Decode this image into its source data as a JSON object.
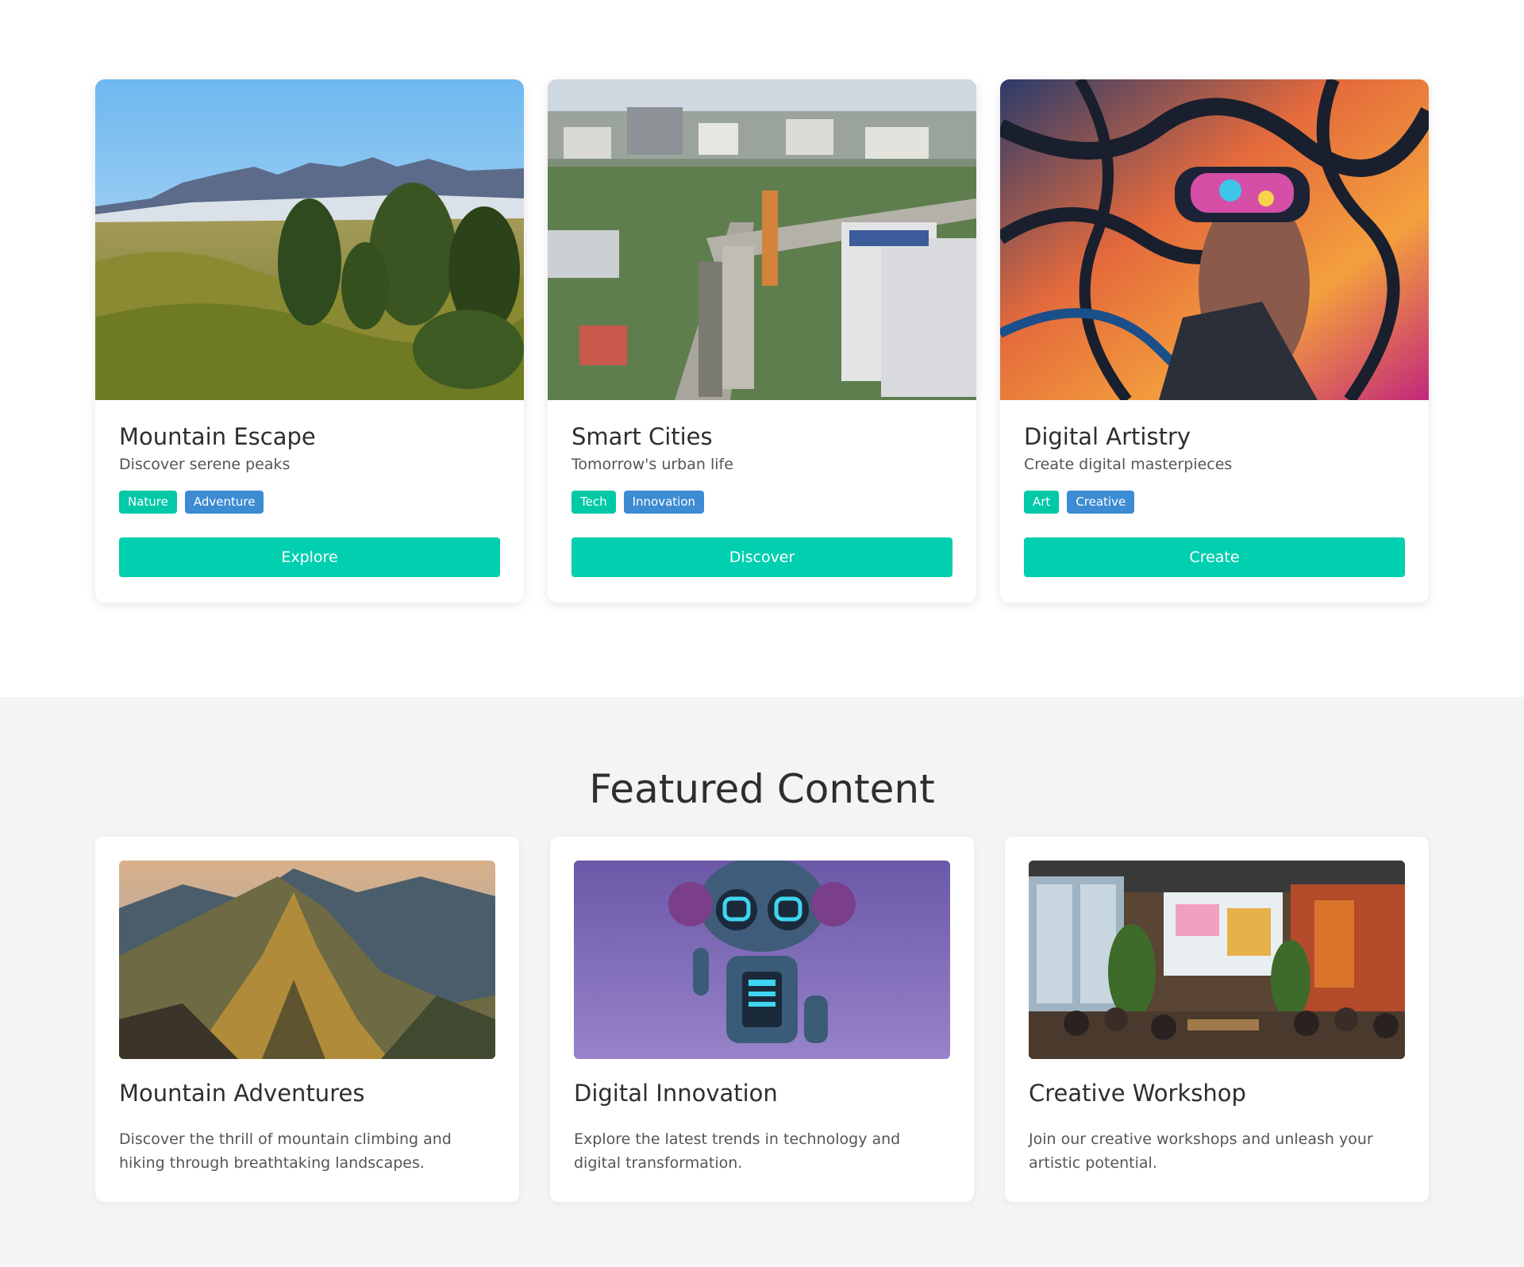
{
  "cards": [
    {
      "title": "Mountain Escape",
      "subtitle": "Discover serene peaks",
      "tags": [
        "Nature",
        "Adventure"
      ],
      "button_label": "Explore",
      "image": "mountain-landscape-image"
    },
    {
      "title": "Smart Cities",
      "subtitle": "Tomorrow's urban life",
      "tags": [
        "Tech",
        "Innovation"
      ],
      "button_label": "Discover",
      "image": "city-aerial-image"
    },
    {
      "title": "Digital Artistry",
      "subtitle": "Create digital masterpieces",
      "tags": [
        "Art",
        "Creative"
      ],
      "button_label": "Create",
      "image": "vr-art-image"
    }
  ],
  "featured": {
    "heading": "Featured Content",
    "items": [
      {
        "title": "Mountain Adventures",
        "description": "Discover the thrill of mountain climbing and hiking through breathtaking landscapes.",
        "image": "mountain-ridge-image"
      },
      {
        "title": "Digital Innovation",
        "description": "Explore the latest trends in technology and digital transformation.",
        "image": "robot-image"
      },
      {
        "title": "Creative Workshop",
        "description": "Join our creative workshops and unleash your artistic potential.",
        "image": "workshop-image"
      }
    ]
  },
  "colors": {
    "accent": "#00cfb0",
    "tag_primary": "#00c9a7",
    "tag_secondary": "#3d8bd3",
    "featured_bg": "#f4f4f4"
  }
}
